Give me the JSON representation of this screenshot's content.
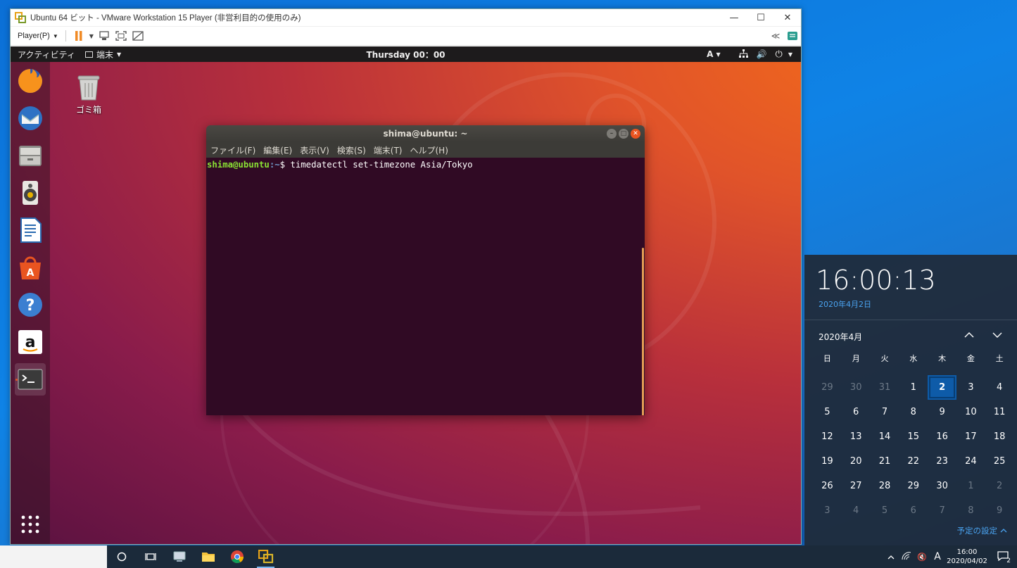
{
  "vmware": {
    "title": "Ubuntu 64 ビット - VMware Workstation 15 Player (非営利目的の使用のみ)",
    "player_menu": "Player(P)",
    "window_controls": [
      "minimize-icon",
      "maximize-icon",
      "close-icon"
    ]
  },
  "ubuntu": {
    "activities": "アクティビティ",
    "app_menu": "端末",
    "clock": "Thursday 00：00",
    "input_indicator": "A",
    "dock_apps": [
      "firefox",
      "thunderbird",
      "files",
      "rhythmbox",
      "libreoffice-writer",
      "software-center",
      "help",
      "amazon",
      "terminal"
    ],
    "trash_label": "ゴミ箱"
  },
  "terminal": {
    "title": "shima@ubuntu: ~",
    "menu": [
      "ファイル(F)",
      "編集(E)",
      "表示(V)",
      "検索(S)",
      "端末(T)",
      "ヘルプ(H)"
    ],
    "prompt_user": "shima@ubuntu",
    "prompt_path": ":~",
    "prompt_symbol": "$ ",
    "command": "timedatectl set-timezone Asia/Tokyo"
  },
  "clock_flyout": {
    "time": "16:00:13",
    "date": "2020年4月2日",
    "month": "2020年4月",
    "weekdays": [
      "日",
      "月",
      "火",
      "水",
      "木",
      "金",
      "土"
    ],
    "weeks": [
      [
        "29",
        "30",
        "31",
        "1",
        "2",
        "3",
        "4"
      ],
      [
        "5",
        "6",
        "7",
        "8",
        "9",
        "10",
        "11"
      ],
      [
        "12",
        "13",
        "14",
        "15",
        "16",
        "17",
        "18"
      ],
      [
        "19",
        "20",
        "21",
        "22",
        "23",
        "24",
        "25"
      ],
      [
        "26",
        "27",
        "28",
        "29",
        "30",
        "1",
        "2"
      ],
      [
        "3",
        "4",
        "5",
        "6",
        "7",
        "8",
        "9"
      ]
    ],
    "today": "2",
    "schedule_link": "予定の設定"
  },
  "taskbar": {
    "input_mode": "A",
    "time": "16:00",
    "date": "2020/04/02",
    "notification_count": "2"
  },
  "colors": {
    "ubuntu_orange": "#e95420",
    "terminal_bg": "#300a24",
    "prompt_green": "#8ae234",
    "prompt_blue": "#729fcf",
    "flyout_accent": "#4aa3f0"
  }
}
